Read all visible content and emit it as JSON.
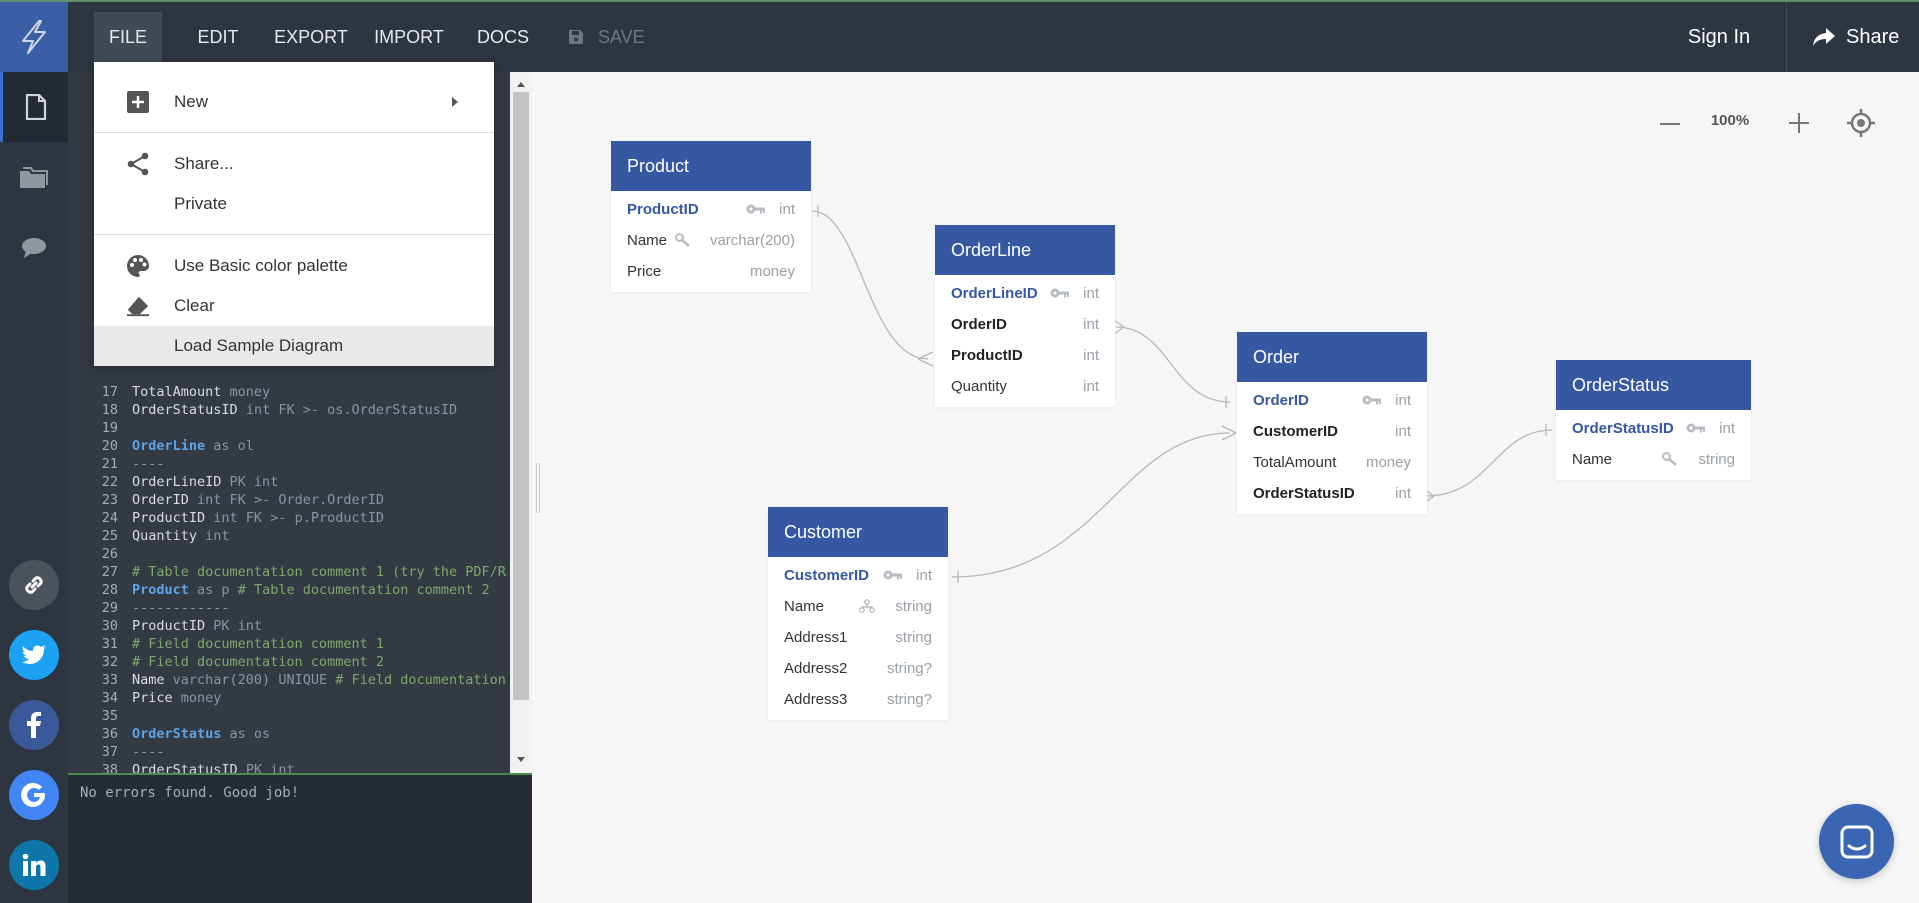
{
  "topbar": {
    "menu": [
      "FILE",
      "EDIT",
      "EXPORT",
      "IMPORT",
      "DOCS"
    ],
    "save_label": "SAVE",
    "signin_label": "Sign In",
    "share_label": "Share"
  },
  "file_menu": {
    "new_label": "New",
    "share_label": "Share...",
    "private_label": "Private",
    "palette_label": "Use Basic color palette",
    "clear_label": "Clear",
    "load_sample_label": "Load Sample Diagram"
  },
  "editor": {
    "lines": [
      {
        "n": "17",
        "html": "<span class='c-text'>TotalAmount</span> <span class='c-kw'>money</span>"
      },
      {
        "n": "18",
        "html": "<span class='c-text'>OrderStatusID</span> <span class='c-kw'>int FK &gt;- os.OrderStatusID</span>"
      },
      {
        "n": "19",
        "html": ""
      },
      {
        "n": "20",
        "html": "<span class='c-tbl'>OrderLine</span> <span class='c-kw'>as ol</span>"
      },
      {
        "n": "21",
        "html": "<span class='c-kw'>----</span>"
      },
      {
        "n": "22",
        "html": "<span class='c-text'>OrderLineID</span> <span class='c-kw'>PK int</span>"
      },
      {
        "n": "23",
        "html": "<span class='c-text'>OrderID</span> <span class='c-kw'>int FK &gt;- Order.OrderID</span>"
      },
      {
        "n": "24",
        "html": "<span class='c-text'>ProductID</span> <span class='c-kw'>int FK &gt;- p.ProductID</span>"
      },
      {
        "n": "25",
        "html": "<span class='c-text'>Quantity</span> <span class='c-kw'>int</span>"
      },
      {
        "n": "26",
        "html": ""
      },
      {
        "n": "27",
        "html": "<span class='c-com'># Table documentation comment 1 (try the PDF/R</span>"
      },
      {
        "n": "28",
        "html": "<span class='c-tbl'>Product</span> <span class='c-kw'>as p</span> <span class='c-com'># Table documentation comment 2</span>"
      },
      {
        "n": "29",
        "html": "<span class='c-kw'>------------</span>"
      },
      {
        "n": "30",
        "html": "<span class='c-text'>ProductID</span> <span class='c-kw'>PK int</span>"
      },
      {
        "n": "31",
        "html": "<span class='c-com'># Field documentation comment 1</span>"
      },
      {
        "n": "32",
        "html": "<span class='c-com'># Field documentation comment 2</span>"
      },
      {
        "n": "33",
        "html": "<span class='c-text'>Name</span> <span class='c-kw'>varchar(200) UNIQUE</span> <span class='c-com'># Field documentation</span>"
      },
      {
        "n": "34",
        "html": "<span class='c-text'>Price</span> <span class='c-kw'>money</span>"
      },
      {
        "n": "35",
        "html": ""
      },
      {
        "n": "36",
        "html": "<span class='c-tbl'>OrderStatus</span> <span class='c-kw'>as os</span>"
      },
      {
        "n": "37",
        "html": "<span class='c-kw'>----</span>"
      },
      {
        "n": "38",
        "html": "<span class='c-text'>OrderStatusID</span> <span class='c-kw'>PK int</span>"
      }
    ],
    "status": "No errors found. Good job!"
  },
  "canvas": {
    "zoom": "100%",
    "tables": {
      "product": {
        "name": "Product",
        "fields": [
          {
            "name": "ProductID",
            "type": "int",
            "kind": "pk"
          },
          {
            "name": "Name",
            "type": "varchar(200)",
            "kind": "unique"
          },
          {
            "name": "Price",
            "type": "money",
            "kind": ""
          }
        ]
      },
      "orderline": {
        "name": "OrderLine",
        "fields": [
          {
            "name": "OrderLineID",
            "type": "int",
            "kind": "pk"
          },
          {
            "name": "OrderID",
            "type": "int",
            "kind": "fk"
          },
          {
            "name": "ProductID",
            "type": "int",
            "kind": "fk"
          },
          {
            "name": "Quantity",
            "type": "int",
            "kind": ""
          }
        ]
      },
      "order": {
        "name": "Order",
        "fields": [
          {
            "name": "OrderID",
            "type": "int",
            "kind": "pk"
          },
          {
            "name": "CustomerID",
            "type": "int",
            "kind": "fk"
          },
          {
            "name": "TotalAmount",
            "type": "money",
            "kind": ""
          },
          {
            "name": "OrderStatusID",
            "type": "int",
            "kind": "fk"
          }
        ]
      },
      "orderstatus": {
        "name": "OrderStatus",
        "fields": [
          {
            "name": "OrderStatusID",
            "type": "int",
            "kind": "pk"
          },
          {
            "name": "Name",
            "type": "string",
            "kind": "unique"
          }
        ]
      },
      "customer": {
        "name": "Customer",
        "fields": [
          {
            "name": "CustomerID",
            "type": "int",
            "kind": "pk"
          },
          {
            "name": "Name",
            "type": "string",
            "kind": "index"
          },
          {
            "name": "Address1",
            "type": "string",
            "kind": ""
          },
          {
            "name": "Address2",
            "type": "string?",
            "kind": ""
          },
          {
            "name": "Address3",
            "type": "string?",
            "kind": ""
          }
        ]
      }
    }
  },
  "colors": {
    "table_header": "#3657a2",
    "topbar": "#2d3540",
    "logo_bg": "#3b5fa6",
    "twitter": "#1da1f2",
    "facebook": "#3b5998",
    "google": "#4285f4",
    "linkedin": "#0e76a8"
  },
  "icons": {
    "logo": "bolt-icon",
    "rail": [
      "document-icon",
      "folder-icon",
      "chat-icon"
    ],
    "social": [
      "link-icon",
      "twitter-icon",
      "facebook-icon",
      "google-icon",
      "linkedin-icon"
    ]
  }
}
